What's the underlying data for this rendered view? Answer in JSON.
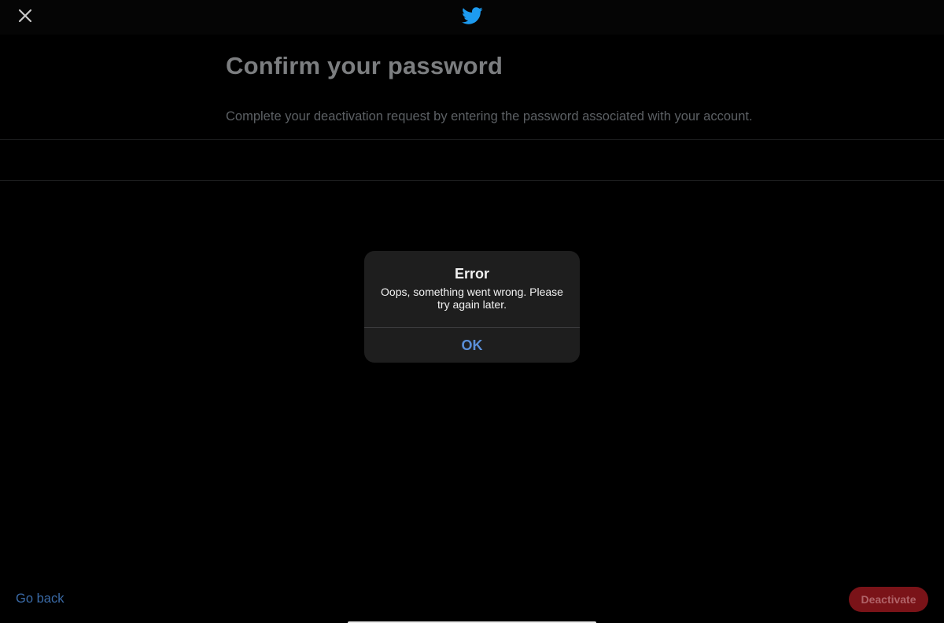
{
  "header": {
    "close_icon": "close-icon",
    "logo_icon": "twitter-bird-icon",
    "logo_color": "#1d9bf0"
  },
  "page": {
    "title": "Confirm your password",
    "subtitle": "Complete your deactivation request by entering the password associated with your account.",
    "password_value": "",
    "password_placeholder": ""
  },
  "dialog": {
    "title": "Error",
    "message": "Oops, something went wrong. Please try again later.",
    "ok_label": "OK",
    "ok_color": "#5a8fd8"
  },
  "footer": {
    "back_label": "Go back",
    "deactivate_label": "Deactivate",
    "deactivate_color": "#7a1318"
  }
}
